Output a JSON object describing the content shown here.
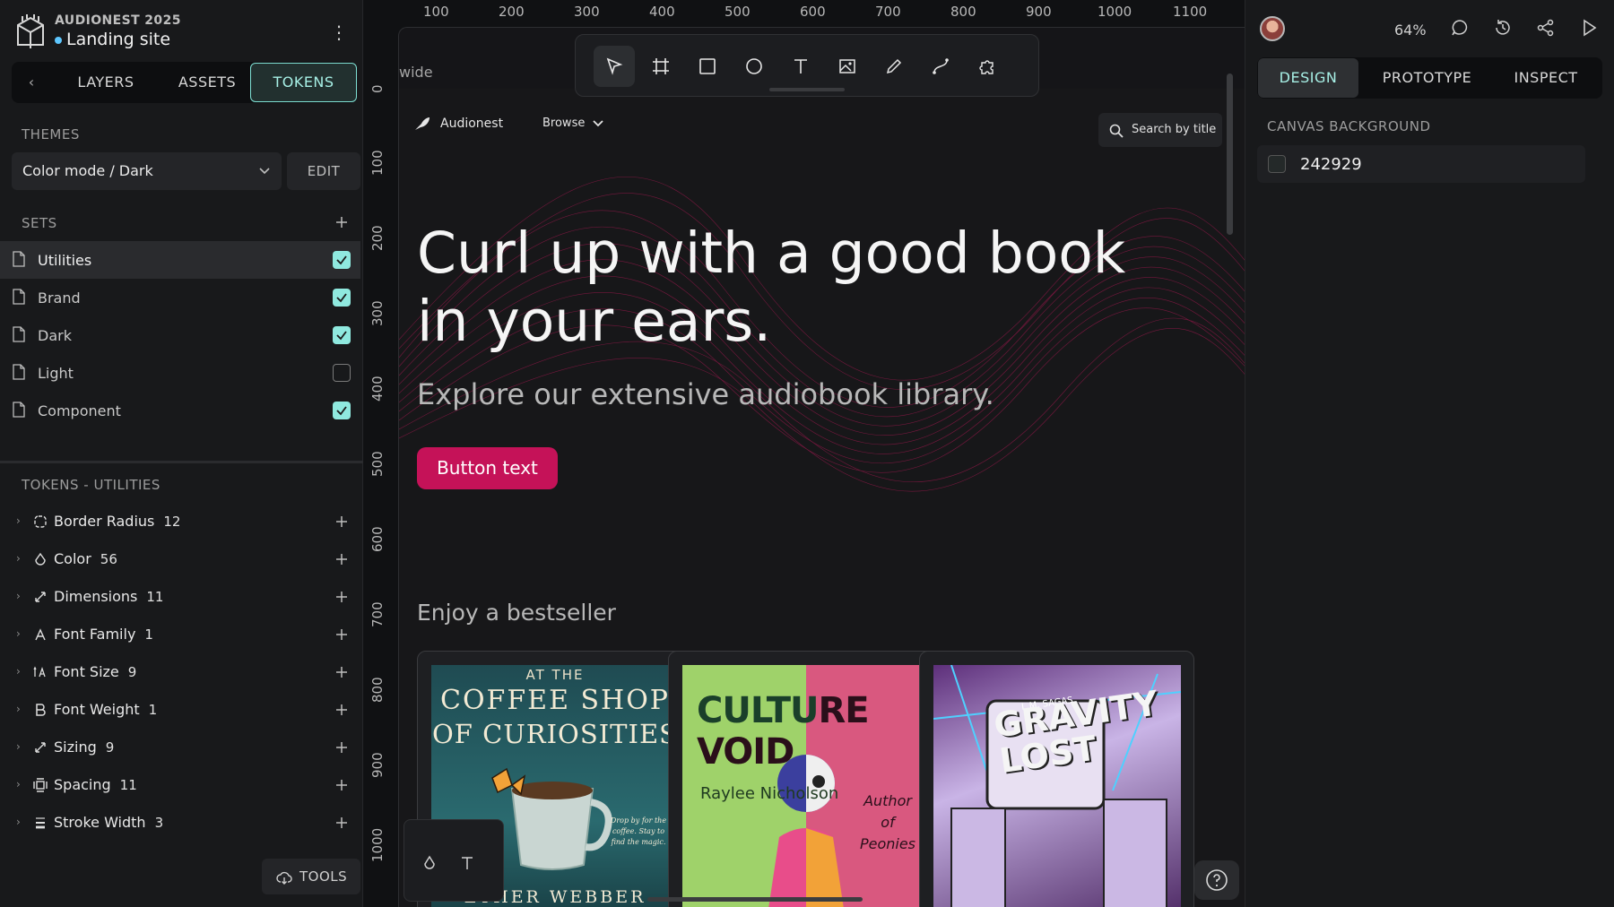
{
  "project": {
    "company": "AUDIONEST 2025",
    "name": "Landing site"
  },
  "left_tabs": {
    "layers": "LAYERS",
    "assets": "ASSETS",
    "tokens": "TOKENS"
  },
  "themes": {
    "label": "THEMES",
    "selected": "Color mode / Dark",
    "edit": "EDIT"
  },
  "sets": {
    "label": "SETS",
    "items": [
      {
        "label": "Utilities",
        "checked": true,
        "active": true
      },
      {
        "label": "Brand",
        "checked": true
      },
      {
        "label": "Dark",
        "checked": true
      },
      {
        "label": "Light",
        "checked": false
      },
      {
        "label": "Component",
        "checked": true
      }
    ]
  },
  "tokens": {
    "label": "TOKENS - UTILITIES",
    "items": [
      {
        "name": "Border Radius",
        "count": "12",
        "icon": "border-radius-icon"
      },
      {
        "name": "Color",
        "count": "56",
        "icon": "color-drop-icon"
      },
      {
        "name": "Dimensions",
        "count": "11",
        "icon": "dimensions-icon"
      },
      {
        "name": "Font Family",
        "count": "1",
        "icon": "font-family-icon"
      },
      {
        "name": "Font Size",
        "count": "9",
        "icon": "font-size-icon"
      },
      {
        "name": "Font Weight",
        "count": "1",
        "icon": "font-weight-icon"
      },
      {
        "name": "Sizing",
        "count": "9",
        "icon": "sizing-icon"
      },
      {
        "name": "Spacing",
        "count": "11",
        "icon": "spacing-icon"
      },
      {
        "name": "Stroke Width",
        "count": "3",
        "icon": "stroke-width-icon"
      }
    ]
  },
  "tools_button": "TOOLS",
  "rulers": {
    "top": [
      "100",
      "200",
      "300",
      "400",
      "500",
      "600",
      "700",
      "800",
      "900",
      "1000",
      "1100"
    ],
    "left": [
      "0",
      "100",
      "200",
      "300",
      "400",
      "500",
      "600",
      "700",
      "800",
      "900",
      "1000"
    ]
  },
  "canvas": {
    "board_label": "wide",
    "site": {
      "brand": "Audionest",
      "browse": "Browse",
      "search": "Search by title",
      "hero_title": "Curl up with a good book in your ears.",
      "hero_sub": "Explore our extensive audiobook library.",
      "button": "Button text",
      "section": "Enjoy a bestseller",
      "books": [
        {
          "line1": "AT THE",
          "line2": "COFFEE SHOP",
          "line3": "OF CURIOSITIES",
          "author": "ETHER WEBBER",
          "tagline": "Drop by for the coffee. Stay to find the magic."
        },
        {
          "title_a": "CULTU",
          "title_b": "RE VOID",
          "author": "Raylee Nicholson",
          "note": "Author of Peonies"
        },
        {
          "small": "L.M. SAGAS",
          "title": "GRAVITY LOST"
        }
      ]
    }
  },
  "right": {
    "zoom": "64%",
    "tabs": {
      "design": "DESIGN",
      "prototype": "PROTOTYPE",
      "inspect": "INSPECT"
    },
    "canvas_bg_label": "CANVAS BACKGROUND",
    "canvas_bg_value": "242929"
  },
  "colors": {
    "accent": "#8fe9df",
    "brand_pink": "#c51258",
    "canvas_bg": "#242929"
  }
}
